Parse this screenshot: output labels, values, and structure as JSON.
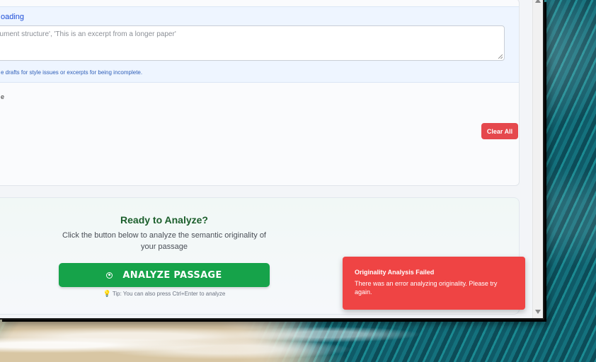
{
  "context": {
    "label": "oading",
    "textarea_placeholder": "gument structure', 'This is an excerpt from a longer paper'",
    "hint": "e drafts for style issues or excerpts for being incomplete."
  },
  "style_section": {
    "label": "e"
  },
  "clear_button_label": "Clear All",
  "ready": {
    "title": "Ready to Analyze?",
    "description": "Click the button below to analyze the semantic originality of your passage",
    "analyze_button_label": "ANALYZE PASSAGE",
    "tip": "Tip: You can also press Ctrl+Enter to analyze"
  },
  "toast": {
    "title": "Originality Analysis Failed",
    "message": "There was an error analyzing originality. Please try again."
  },
  "colors": {
    "accent_green": "#16a34a",
    "danger_red": "#ef4444",
    "link_blue": "#1d4ed8"
  },
  "icons": {
    "analyze": "target-circle-icon",
    "tip": "lightbulb-icon"
  }
}
